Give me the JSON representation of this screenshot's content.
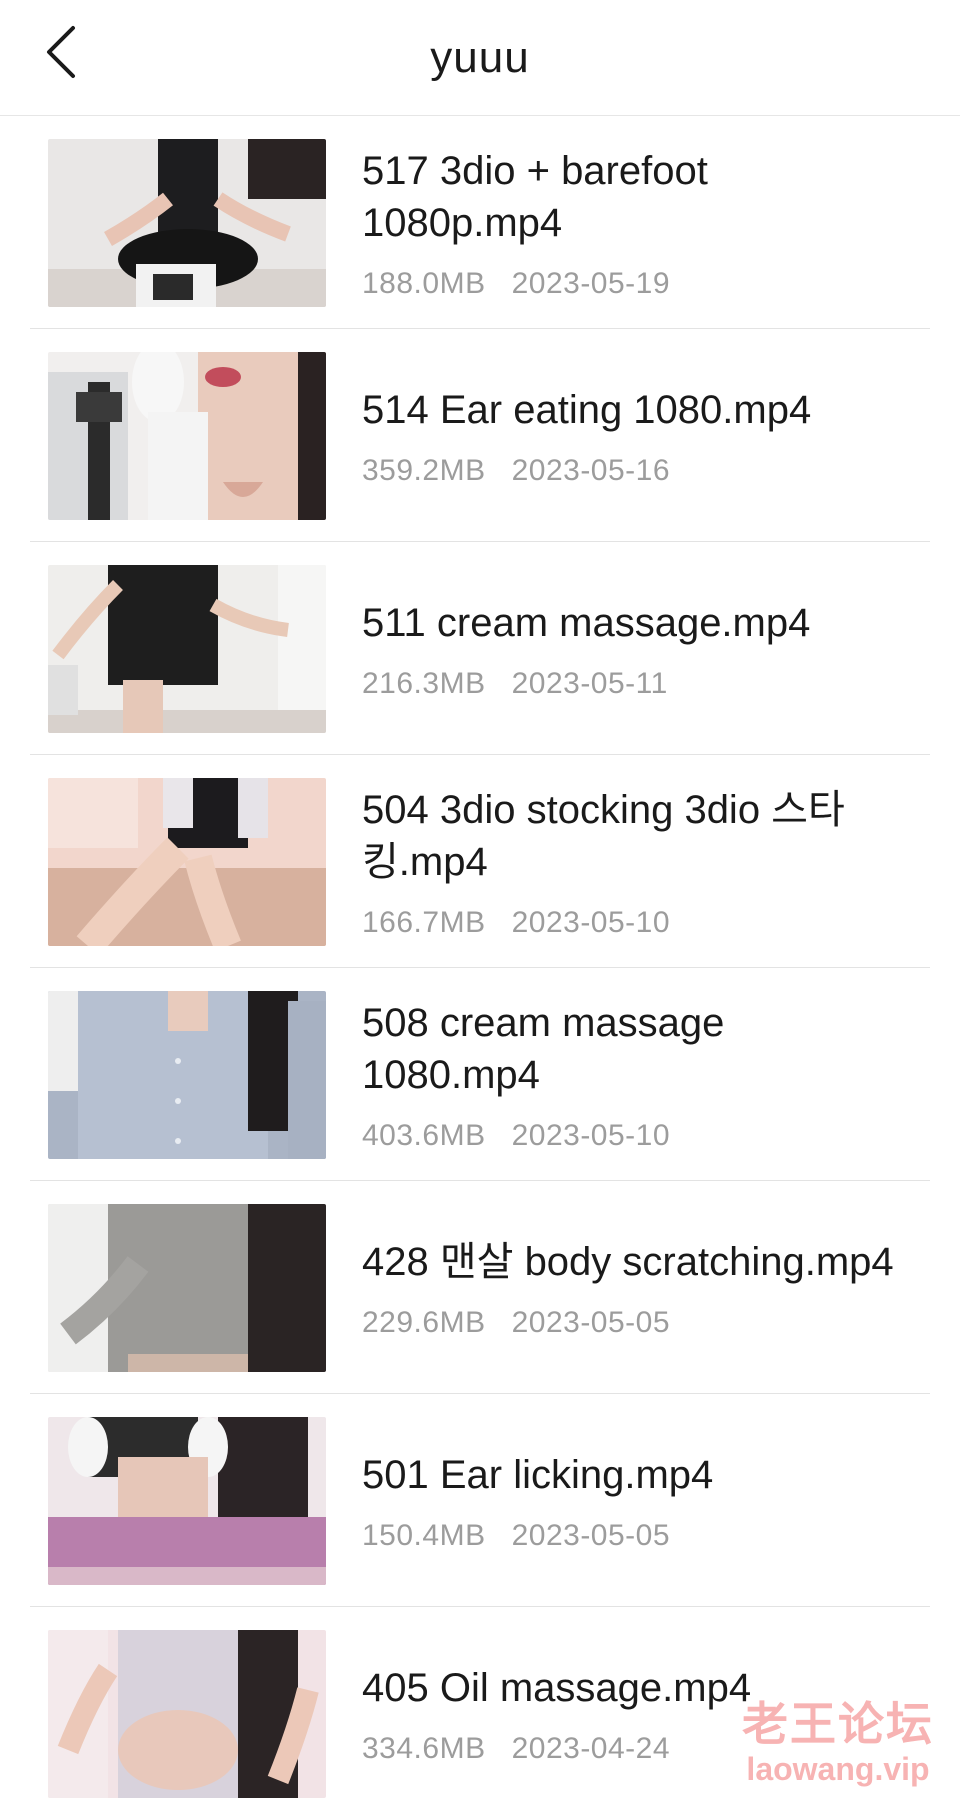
{
  "header": {
    "title": "yuuu",
    "back_icon": "chevron-left-icon"
  },
  "files": [
    {
      "name": "517 3dio + barefoot 1080p.mp4",
      "size": "188.0MB",
      "date": "2023-05-19"
    },
    {
      "name": "514 Ear eating 1080.mp4",
      "size": "359.2MB",
      "date": "2023-05-16"
    },
    {
      "name": "511 cream massage.mp4",
      "size": "216.3MB",
      "date": "2023-05-11"
    },
    {
      "name": "504 3dio stocking 3dio 스타킹.mp4",
      "size": "166.7MB",
      "date": "2023-05-10"
    },
    {
      "name": "508 cream massage 1080.mp4",
      "size": "403.6MB",
      "date": "2023-05-10"
    },
    {
      "name": "428 맨살 body scratching.mp4",
      "size": "229.6MB",
      "date": "2023-05-05"
    },
    {
      "name": "501 Ear licking.mp4",
      "size": "150.4MB",
      "date": "2023-05-05"
    },
    {
      "name": "405 Oil massage.mp4",
      "size": "334.6MB",
      "date": "2023-04-24"
    }
  ],
  "watermark": {
    "text": "老王论坛",
    "url": "laowang.vip"
  }
}
